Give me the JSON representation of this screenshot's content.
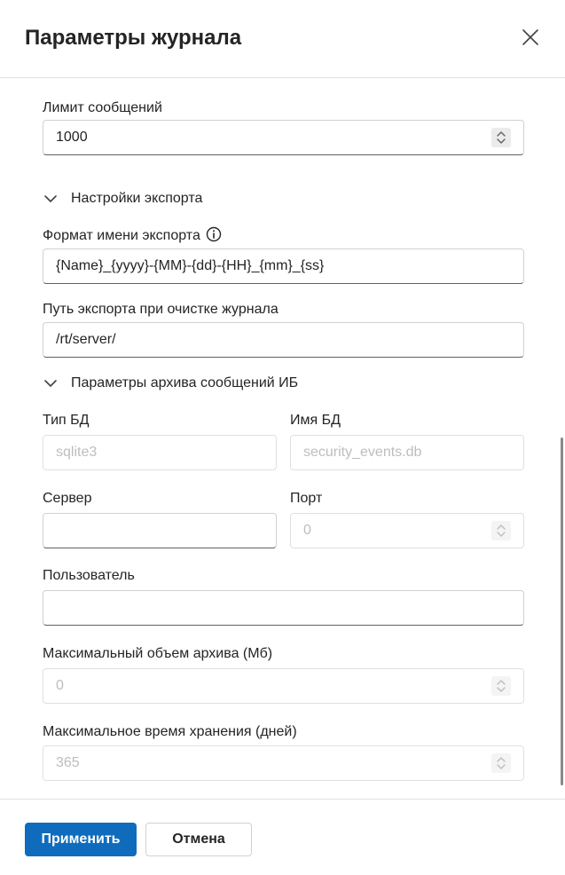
{
  "dialog": {
    "title": "Параметры журнала"
  },
  "fields": {
    "message_limit": {
      "label": "Лимит сообщений",
      "value": "1000"
    },
    "export_name_format": {
      "label": "Формат имени экспорта",
      "value": "{Name}_{yyyy}-{MM}-{dd}-{HH}_{mm}_{ss}"
    },
    "export_path": {
      "label": "Путь экспорта при очистке журнала",
      "value": "/rt/server/"
    },
    "db_type": {
      "label": "Тип БД",
      "value": "sqlite3"
    },
    "db_name": {
      "label": "Имя БД",
      "value": "security_events.db"
    },
    "server": {
      "label": "Сервер",
      "value": ""
    },
    "port": {
      "label": "Порт",
      "value": "0"
    },
    "user": {
      "label": "Пользователь",
      "value": ""
    },
    "max_archive_size": {
      "label": "Максимальный объем архива (Мб)",
      "value": "0"
    },
    "max_retention": {
      "label": "Максимальное время хранения (дней)",
      "value": "365"
    }
  },
  "sections": {
    "export": "Настройки экспорта",
    "archive": "Параметры архива сообщений ИБ"
  },
  "footer": {
    "apply": "Применить",
    "cancel": "Отмена"
  },
  "colors": {
    "primary": "#0f6cbd",
    "text": "#242424",
    "disabled_text": "#bdbdbd"
  },
  "icons": {
    "close": "close-icon",
    "chevron": "chevron-down-icon",
    "info": "info-icon",
    "spin": "spin-button-icon"
  }
}
